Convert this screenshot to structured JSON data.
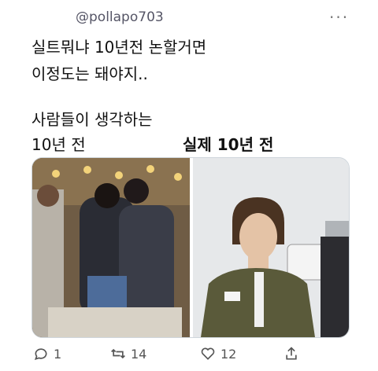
{
  "tweet": {
    "handle": "@pollapo703",
    "more_label": "···",
    "lines": [
      "실트뭐냐 10년전 논할거면",
      "이정도는 돼야지..",
      "사람들이 생각하는"
    ],
    "caption_left": "10년 전",
    "caption_right": "실제 10년 전"
  },
  "media": {
    "left_icon": "photo-couple-carousel",
    "right_icon": "photo-woman-green-jacket"
  },
  "actions": {
    "reply_count": "1",
    "retweet_count": "14",
    "like_count": "12",
    "icons": [
      "reply-icon",
      "retweet-icon",
      "like-icon",
      "share-icon"
    ]
  },
  "colors": {
    "text": "#111111",
    "muted": "#555555",
    "border": "#cfd6dc",
    "jacket": "#5a5a3a"
  }
}
